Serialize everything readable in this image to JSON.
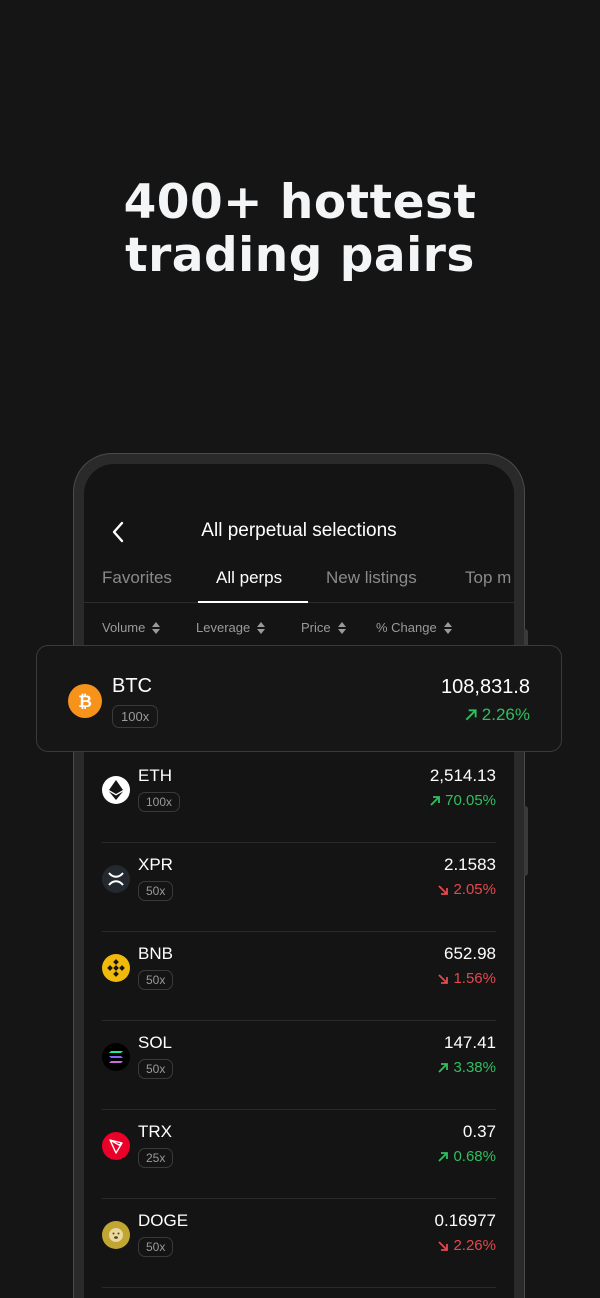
{
  "headline": {
    "line1": "400+ hottest",
    "line2": "trading pairs"
  },
  "nav": {
    "back_icon": "chevron-left-icon",
    "title": "All perpetual selections"
  },
  "tabs": [
    {
      "label": "Favorites",
      "active": false
    },
    {
      "label": "All perps",
      "active": true
    },
    {
      "label": "New listings",
      "active": false
    },
    {
      "label": "Top m",
      "active": false
    }
  ],
  "sort_columns": [
    {
      "label": "Volume",
      "icon": "sort-icon"
    },
    {
      "label": "Leverage",
      "icon": "sort-icon"
    },
    {
      "label": "Price",
      "icon": "sort-icon"
    },
    {
      "label": "% Change",
      "icon": "sort-icon"
    }
  ],
  "highlight": {
    "symbol": "BTC",
    "leverage": "100x",
    "price": "108,831.8",
    "change": "2.26%",
    "direction": "up",
    "icon": "bitcoin-icon",
    "icon_color": "#f7931a"
  },
  "pairs": [
    {
      "symbol": "ETH",
      "leverage": "100x",
      "price": "2,514.13",
      "change": "70.05%",
      "direction": "up",
      "icon": "ethereum-icon",
      "icon_color": "#ffffff"
    },
    {
      "symbol": "XPR",
      "leverage": "50x",
      "price": "2.1583",
      "change": "2.05%",
      "direction": "down",
      "icon": "xrp-icon",
      "icon_color": "#23292f"
    },
    {
      "symbol": "BNB",
      "leverage": "50x",
      "price": "652.98",
      "change": "1.56%",
      "direction": "down",
      "icon": "bnb-icon",
      "icon_color": "#f0b90b"
    },
    {
      "symbol": "SOL",
      "leverage": "50x",
      "price": "147.41",
      "change": "3.38%",
      "direction": "up",
      "icon": "solana-icon",
      "icon_color": "#000000"
    },
    {
      "symbol": "TRX",
      "leverage": "25x",
      "price": "0.37",
      "change": "0.68%",
      "direction": "up",
      "icon": "tron-icon",
      "icon_color": "#eb0029"
    },
    {
      "symbol": "DOGE",
      "leverage": "50x",
      "price": "0.16977",
      "change": "2.26%",
      "direction": "down",
      "icon": "dogecoin-icon",
      "icon_color": "#c2a633"
    }
  ],
  "colors": {
    "background": "#151515",
    "up": "#2fbf5f",
    "down": "#e5484d"
  }
}
